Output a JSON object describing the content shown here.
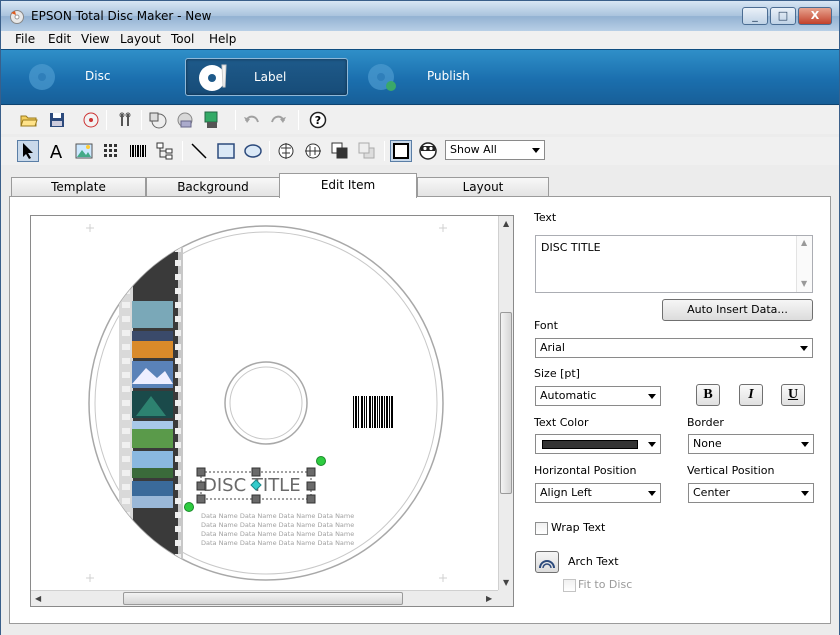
{
  "window": {
    "title": "EPSON Total Disc Maker - New",
    "minimize_label": "_",
    "maximize_label": "□",
    "close_label": "X"
  },
  "menu": {
    "items": [
      "File",
      "Edit",
      "View",
      "Layout",
      "Tool",
      "Help"
    ]
  },
  "modes": [
    {
      "label": "Disc",
      "active": false,
      "icon": "disc-icon"
    },
    {
      "label": "Label",
      "active": true,
      "icon": "label-icon"
    },
    {
      "label": "Publish",
      "active": false,
      "icon": "publish-icon"
    }
  ],
  "toolbar_top": {
    "icons": [
      "open-folder-icon",
      "save-icon",
      "disc-print-icon",
      "tools-icon",
      "import-icon",
      "print-icon",
      "export-icon",
      "undo-icon",
      "redo-icon",
      "help-icon"
    ]
  },
  "toolbar_tools": {
    "icons": [
      "select-arrow-icon",
      "text-tool-icon",
      "image-tool-icon",
      "grid-tool-icon",
      "barcode-tool-icon",
      "tree-tool-icon",
      "line-tool-icon",
      "rectangle-tool-icon",
      "ellipse-tool-icon",
      "align-center-icon",
      "align-middle-icon",
      "bring-forward-icon",
      "send-backward-icon",
      "frame-toggle-icon",
      "face-icon"
    ],
    "view_select": "Show All"
  },
  "tabs": [
    "Template",
    "Background",
    "Edit Item",
    "Layout"
  ],
  "active_tab": "Edit Item",
  "canvas": {
    "disc_title_text": "DISC TITLE",
    "data_name_rows": [
      "Data Name Data Name Data Name Data Name",
      "Data Name Data Name Data Name Data Name",
      "Data Name Data Name Data Name Data Name",
      "Data Name Data Name Data Name Data Name"
    ]
  },
  "properties": {
    "text_label": "Text",
    "text_value": "DISC TITLE",
    "auto_insert_label": "Auto Insert Data...",
    "font_label": "Font",
    "font_value": "Arial",
    "size_label": "Size [pt]",
    "size_value": "Automatic",
    "bold_label": "B",
    "italic_label": "I",
    "underline_label": "U",
    "text_color_label": "Text Color",
    "text_color_value": "#333333",
    "border_label": "Border",
    "border_value": "None",
    "hpos_label": "Horizontal Position",
    "hpos_value": "Align Left",
    "vpos_label": "Vertical Position",
    "vpos_value": "Center",
    "wrap_text_label": "Wrap Text",
    "arch_text_label": "Arch Text",
    "fit_to_disc_label": "Fit to Disc"
  },
  "colors": {
    "mode_bar": "#1b6fae",
    "selection_handle": "#5a5a5a",
    "rotate_handle": "#2ecc40",
    "anchor_handle": "#33cccc"
  }
}
